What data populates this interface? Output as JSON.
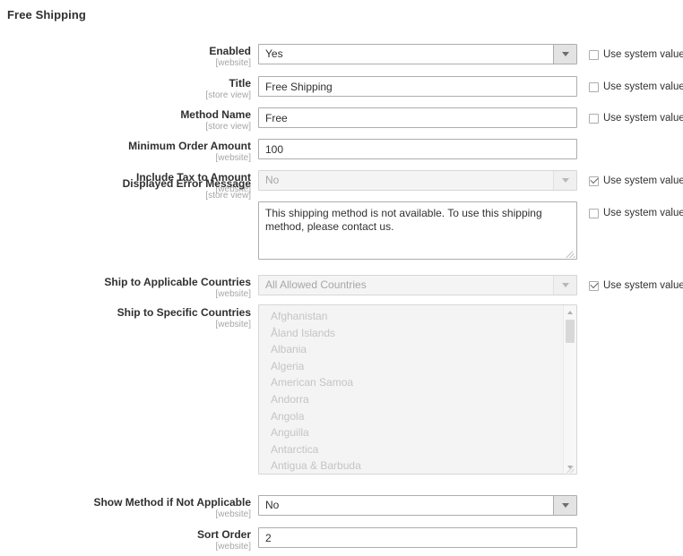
{
  "page": {
    "title": "Free Shipping"
  },
  "system_value_label": "Use system value",
  "fields": [
    {
      "label": "Enabled",
      "scope": "[website]",
      "type": "select",
      "value": "Yes",
      "disabled": false,
      "system_value": {
        "shown": true,
        "checked": false
      }
    },
    {
      "label": "Title",
      "scope": "[store view]",
      "type": "text",
      "value": "Free Shipping",
      "disabled": false,
      "system_value": {
        "shown": true,
        "checked": false
      }
    },
    {
      "label": "Method Name",
      "scope": "[store view]",
      "type": "text",
      "value": "Free",
      "disabled": false,
      "system_value": {
        "shown": true,
        "checked": false
      }
    },
    {
      "label": "Minimum Order Amount",
      "scope": "[website]",
      "type": "text",
      "value": "100",
      "disabled": false,
      "system_value": {
        "shown": false,
        "checked": false
      }
    },
    {
      "label": "Include Tax to Amount",
      "scope": "[website]",
      "type": "select",
      "value": "No",
      "disabled": true,
      "system_value": {
        "shown": true,
        "checked": true
      }
    },
    {
      "label": "Displayed Error Message",
      "scope": "[store view]",
      "type": "textarea",
      "value": "This shipping method is not available. To use this shipping method, please contact us.",
      "disabled": false,
      "system_value": {
        "shown": true,
        "checked": false
      }
    },
    {
      "label": "Ship to Applicable Countries",
      "scope": "[website]",
      "type": "select",
      "value": "All Allowed Countries",
      "disabled": true,
      "system_value": {
        "shown": true,
        "checked": true
      }
    },
    {
      "label": "Ship to Specific Countries",
      "scope": "[website]",
      "type": "multiselect",
      "disabled": true,
      "options": [
        "Afghanistan",
        "Åland Islands",
        "Albania",
        "Algeria",
        "American Samoa",
        "Andorra",
        "Angola",
        "Anguilla",
        "Antarctica",
        "Antigua & Barbuda"
      ],
      "system_value": {
        "shown": false,
        "checked": false
      }
    },
    {
      "label": "Show Method if Not Applicable",
      "scope": "[website]",
      "type": "select",
      "value": "No",
      "disabled": false,
      "system_value": {
        "shown": false,
        "checked": false
      }
    },
    {
      "label": "Sort Order",
      "scope": "[website]",
      "type": "text",
      "value": "2",
      "disabled": false,
      "system_value": {
        "shown": false,
        "checked": false
      }
    }
  ],
  "layout": {
    "row_tops": [
      49,
      85,
      120,
      155,
      190,
      225,
      307,
      340,
      553,
      589
    ],
    "label_tops": [
      51,
      87,
      122,
      157,
      192,
      199,
      309,
      343,
      555,
      591
    ],
    "checkbox_tops": [
      55,
      91,
      126,
      0,
      196,
      232,
      313,
      0,
      0,
      0
    ]
  }
}
